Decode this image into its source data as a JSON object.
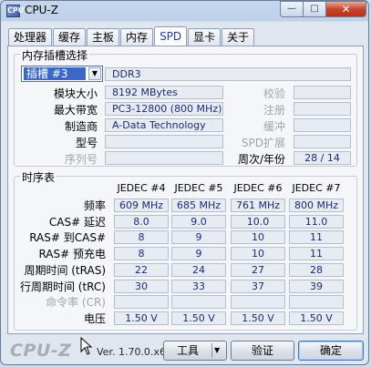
{
  "window": {
    "title": "CPU-Z",
    "icon_text": "CPU",
    "min_symbol": "—",
    "max_symbol": "□",
    "close_symbol": "✕"
  },
  "tabs": [
    {
      "label": "处理器"
    },
    {
      "label": "缓存"
    },
    {
      "label": "主板"
    },
    {
      "label": "内存"
    },
    {
      "label": "SPD",
      "active": true
    },
    {
      "label": "显卡"
    },
    {
      "label": "关于"
    }
  ],
  "slot_group": {
    "title": "内存插槽选择",
    "selected_slot": "插槽 #3",
    "memory_type": "DDR3",
    "module_size_label": "模块大小",
    "module_size": "8192 MBytes",
    "max_bandwidth_label": "最大带宽",
    "max_bandwidth": "PC3-12800 (800 MHz)",
    "manufacturer_label": "制造商",
    "manufacturer": "A-Data Technology",
    "part_number_label": "型号",
    "part_number": "",
    "serial_label": "序列号",
    "serial": "",
    "checksum_label": "校验",
    "checksum": "",
    "registered_label": "注册",
    "registered": "",
    "buffered_label": "缓冲",
    "buffered": "",
    "spd_ext_label": "SPD扩展",
    "spd_ext": "",
    "week_year_label": "周次/年份",
    "week_year": "28 / 14"
  },
  "timings": {
    "title": "时序表",
    "columns": [
      "JEDEC #4",
      "JEDEC #5",
      "JEDEC #6",
      "JEDEC #7"
    ],
    "rows": [
      {
        "label": "频率",
        "values": [
          "609 MHz",
          "685 MHz",
          "761 MHz",
          "800 MHz"
        ],
        "dim": false
      },
      {
        "label": "CAS# 延迟",
        "values": [
          "8.0",
          "9.0",
          "10.0",
          "11.0"
        ],
        "dim": false
      },
      {
        "label": "RAS# 到CAS#",
        "values": [
          "8",
          "9",
          "10",
          "11"
        ],
        "dim": false
      },
      {
        "label": "RAS# 预充电",
        "values": [
          "8",
          "9",
          "10",
          "11"
        ],
        "dim": false
      },
      {
        "label": "周期时间 (tRAS)",
        "values": [
          "22",
          "24",
          "27",
          "28"
        ],
        "dim": false
      },
      {
        "label": "行周期时间 (tRC)",
        "values": [
          "30",
          "33",
          "37",
          "39"
        ],
        "dim": false
      },
      {
        "label": "命令率 (CR)",
        "values": [
          "",
          "",
          "",
          ""
        ],
        "dim": true
      },
      {
        "label": "电压",
        "values": [
          "1.50 V",
          "1.50 V",
          "1.50 V",
          "1.50 V"
        ],
        "dim": false
      }
    ]
  },
  "footer": {
    "logo": "CPU-Z",
    "version": "Ver. 1.70.0.x64",
    "tools_label": "工具",
    "validate_label": "验证",
    "ok_label": "确定"
  }
}
